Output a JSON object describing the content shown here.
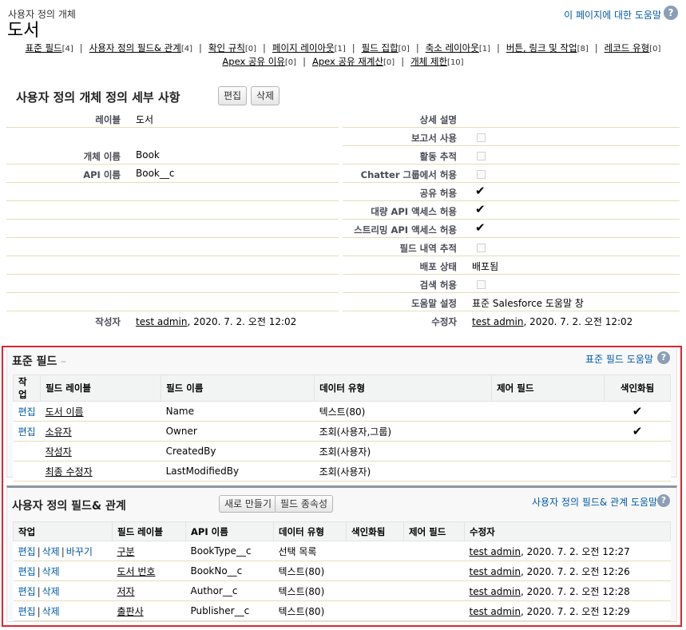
{
  "header": {
    "subtitle": "사용자 정의 개체",
    "title": "도서",
    "help_link": "이 페이지에 대한 도움말",
    "help_icon": "?"
  },
  "quick_links": {
    "row1": [
      {
        "label": "표준 필드",
        "count": "[4]"
      },
      {
        "label": "사용자 정의 필드& 관계",
        "count": "[4]"
      },
      {
        "label": "확인 규칙",
        "count": "[0]"
      },
      {
        "label": "페이지 레이아웃",
        "count": "[1]"
      },
      {
        "label": "필드 집합",
        "count": "[0]"
      },
      {
        "label": "축소 레이아웃",
        "count": "[1]"
      },
      {
        "label": "버튼, 링크 및 작업",
        "count": "[8]"
      },
      {
        "label": "레코드 유형",
        "count": "[0]"
      }
    ],
    "row2": [
      {
        "label": "Apex 공유 이유",
        "count": "[0]"
      },
      {
        "label": "Apex 공유 재계산",
        "count": "[0]"
      },
      {
        "label": "개체 제한",
        "count": "[10]"
      }
    ],
    "separator": "|"
  },
  "detail": {
    "title": "사용자 정의 개체 정의 세부 사항",
    "edit_button": "편집",
    "delete_button": "삭제",
    "label_label": "레이블",
    "label_value": "도서",
    "object_name_label": "개체 이름",
    "object_name_value": "Book",
    "api_name_label": "API 이름",
    "api_name_value": "Book__c",
    "description_label": "상세 설명",
    "reports_label": "보고서 사용",
    "reports_value": false,
    "activity_label": "활동 추적",
    "activity_value": false,
    "chatter_label": "Chatter 그룹에서 허용",
    "chatter_value": false,
    "sharing_label": "공유 허용",
    "sharing_value": true,
    "bulk_api_label": "대량 API 액세스 허용",
    "bulk_api_value": true,
    "streaming_api_label": "스트리밍 API 액세스 허용",
    "streaming_api_value": true,
    "field_history_label": "필드 내역 추적",
    "field_history_value": false,
    "deploy_status_label": "배포 상태",
    "deploy_status_value": "배포됨",
    "search_label": "검색 허용",
    "search_value": false,
    "help_setting_label": "도움말 설정",
    "help_setting_value": "표준 Salesforce 도움말 창",
    "created_by_label": "작성자",
    "created_by_user": "test admin",
    "created_by_date": ", 2020. 7. 2. 오전 12:02",
    "modified_by_label": "수정자",
    "modified_by_user": "test admin",
    "modified_by_date": ", 2020. 7. 2. 오전 12:02",
    "check_glyph": "✔"
  },
  "standard_fields": {
    "title": "표준 필드",
    "help_link": "표준 필드 도움말",
    "help_icon": "?",
    "columns": [
      "작업",
      "필드 레이블",
      "필드 이름",
      "데이터 유형",
      "제어 필드",
      "색인화됨"
    ],
    "rows": [
      {
        "action": "편집",
        "label": "도서 이름",
        "name": "Name",
        "type": "텍스트(80)",
        "control": "",
        "indexed": "✔"
      },
      {
        "action": "편집",
        "label": "소유자",
        "name": "Owner",
        "type": "조회(사용자,그룹)",
        "control": "",
        "indexed": "✔"
      },
      {
        "action": "",
        "label": "작성자",
        "name": "CreatedBy",
        "type": "조회(사용자)",
        "control": "",
        "indexed": ""
      },
      {
        "action": "",
        "label": "최종 수정자",
        "name": "LastModifiedBy",
        "type": "조회(사용자)",
        "control": "",
        "indexed": ""
      }
    ]
  },
  "custom_fields": {
    "title": "사용자 정의 필드& 관계",
    "new_button": "새로 만들기",
    "deps_button": "필드 종속성",
    "help_link": "사용자 정의 필드& 관계 도움말",
    "help_icon": "?",
    "columns": [
      "작업",
      "필드 레이블",
      "API 이름",
      "데이터 유형",
      "색인화됨",
      "제어 필드",
      "수정자"
    ],
    "action_edit": "편집",
    "action_delete": "삭제",
    "action_replace": "바꾸기",
    "rows": [
      {
        "label": "구분",
        "api": "BookType__c",
        "type": "선택 목록",
        "indexed": "",
        "control": "",
        "modified_user": "test admin",
        "modified_date": ", 2020. 7. 2. 오전 12:27",
        "replace": true
      },
      {
        "label": "도서 번호",
        "api": "BookNo__c",
        "type": "텍스트(80)",
        "indexed": "",
        "control": "",
        "modified_user": "test admin",
        "modified_date": ", 2020. 7. 2. 오전 12:26",
        "replace": false
      },
      {
        "label": "저자",
        "api": "Author__c",
        "type": "텍스트(80)",
        "indexed": "",
        "control": "",
        "modified_user": "test admin",
        "modified_date": ", 2020. 7. 2. 오전 12:28",
        "replace": false
      },
      {
        "label": "출판사",
        "api": "Publisher__c",
        "type": "텍스트(80)",
        "indexed": "",
        "control": "",
        "modified_user": "test admin",
        "modified_date": ", 2020. 7. 2. 오전 12:29",
        "replace": false
      }
    ]
  },
  "colors": {
    "link": "#015ba7",
    "highlight_border": "#d9252f",
    "help_icon_bg": "#8a9eb6"
  }
}
